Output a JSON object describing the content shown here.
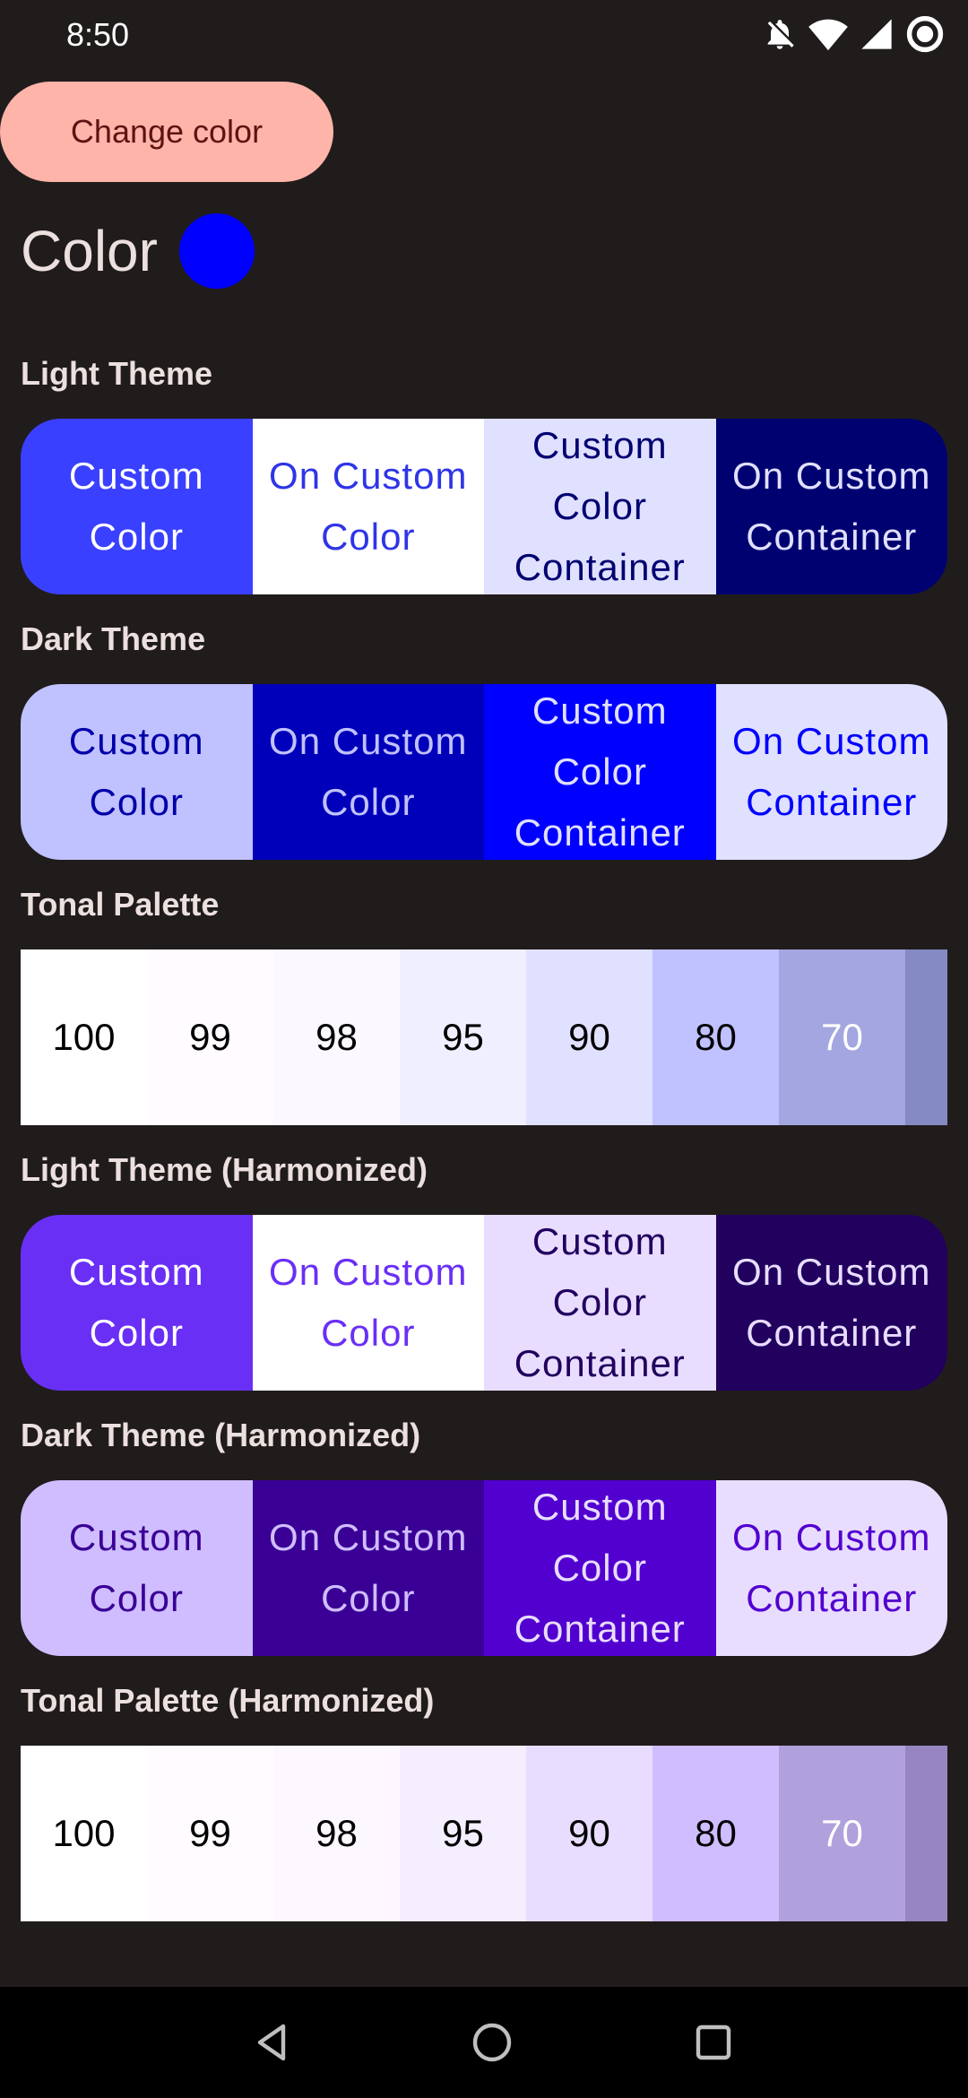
{
  "status_bar": {
    "time": "8:50",
    "icons": [
      "bell-off-icon",
      "wifi-icon",
      "signal-icon",
      "record-icon"
    ]
  },
  "change_button": {
    "label": "Change color"
  },
  "color": {
    "label": "Color",
    "swatch": "#0000ff"
  },
  "sections": {
    "light": {
      "title": "Light Theme",
      "cells": [
        {
          "text": "Custom Color",
          "bg": "#3a40ff",
          "fg": "#ffffff"
        },
        {
          "text": "On Custom Color",
          "bg": "#ffffff",
          "fg": "#2e35e6"
        },
        {
          "text": "Custom Color Container",
          "bg": "#e0e0ff",
          "fg": "#000171"
        },
        {
          "text": "On Custom Container",
          "bg": "#000171",
          "fg": "#e0e0ff"
        }
      ]
    },
    "dark": {
      "title": "Dark Theme",
      "cells": [
        {
          "text": "Custom Color",
          "bg": "#c0c1ff",
          "fg": "#0000a8"
        },
        {
          "text": "On Custom Color",
          "bg": "#0000ba",
          "fg": "#c0c1ff"
        },
        {
          "text": "Custom Color Container",
          "bg": "#0000ff",
          "fg": "#e0e0ff"
        },
        {
          "text": "On Custom Container",
          "bg": "#e0e0ff",
          "fg": "#0000ff"
        }
      ]
    },
    "tonal": {
      "title": "Tonal Palette",
      "tones": [
        {
          "label": "100",
          "bg": "#ffffff",
          "fg": "#000000"
        },
        {
          "label": "99",
          "bg": "#fffbff",
          "fg": "#000000"
        },
        {
          "label": "98",
          "bg": "#fbf8ff",
          "fg": "#000000"
        },
        {
          "label": "95",
          "bg": "#f0efff",
          "fg": "#000000"
        },
        {
          "label": "90",
          "bg": "#e0e0ff",
          "fg": "#000000"
        },
        {
          "label": "80",
          "bg": "#c0c1ff",
          "fg": "#000000"
        },
        {
          "label": "70",
          "bg": "#a3a6e0",
          "fg": "#ffffff"
        },
        {
          "label": "",
          "bg": "#8589c4",
          "fg": "#ffffff"
        }
      ]
    },
    "light_h": {
      "title": "Light Theme (Harmonized)",
      "cells": [
        {
          "text": "Custom Color",
          "bg": "#6a2ff5",
          "fg": "#ffffff"
        },
        {
          "text": "On Custom Color",
          "bg": "#ffffff",
          "fg": "#6a2ff5"
        },
        {
          "text": "Custom Color Container",
          "bg": "#e8ddff",
          "fg": "#21005e"
        },
        {
          "text": "On Custom Container",
          "bg": "#21005e",
          "fg": "#e8ddff"
        }
      ]
    },
    "dark_h": {
      "title": "Dark Theme (Harmonized)",
      "cells": [
        {
          "text": "Custom Color",
          "bg": "#cfbdff",
          "fg": "#3a0095"
        },
        {
          "text": "On Custom Color",
          "bg": "#3a0095",
          "fg": "#cfbdff"
        },
        {
          "text": "Custom Color Container",
          "bg": "#5200cf",
          "fg": "#e8ddff"
        },
        {
          "text": "On Custom Container",
          "bg": "#e8ddff",
          "fg": "#5200cf"
        }
      ]
    },
    "tonal_h": {
      "title": "Tonal Palette (Harmonized)",
      "tones": [
        {
          "label": "100",
          "bg": "#ffffff",
          "fg": "#000000"
        },
        {
          "label": "99",
          "bg": "#fffbff",
          "fg": "#000000"
        },
        {
          "label": "98",
          "bg": "#fdf7ff",
          "fg": "#000000"
        },
        {
          "label": "95",
          "bg": "#f5eeff",
          "fg": "#000000"
        },
        {
          "label": "90",
          "bg": "#e8ddff",
          "fg": "#000000"
        },
        {
          "label": "80",
          "bg": "#cfbdff",
          "fg": "#000000"
        },
        {
          "label": "70",
          "bg": "#b0a0dc",
          "fg": "#ffffff"
        },
        {
          "label": "",
          "bg": "#9685c0",
          "fg": "#ffffff"
        }
      ]
    }
  },
  "nav": {
    "buttons": [
      "back-icon",
      "home-icon",
      "recents-icon"
    ]
  }
}
